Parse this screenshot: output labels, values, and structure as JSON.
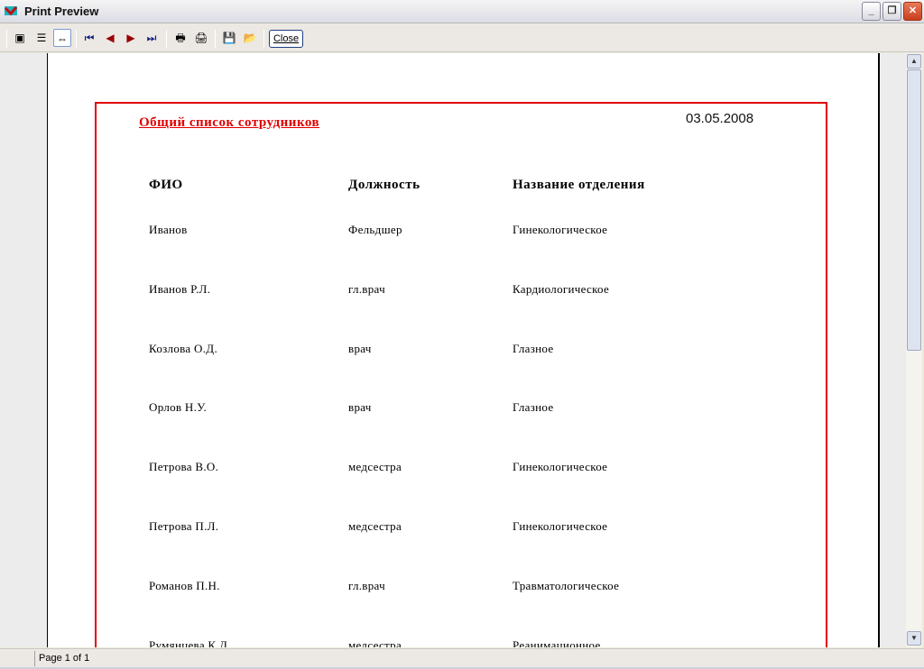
{
  "window": {
    "title": "Print Preview"
  },
  "toolbar": {
    "close_label": "Close"
  },
  "report": {
    "title": "Общий список сотрудников",
    "date": "03.05.2008",
    "headers": [
      "ФИО",
      "Должность",
      "Название отделения"
    ],
    "rows": [
      [
        "Иванов",
        "Фельдшер",
        "Гинекологическое"
      ],
      [
        "Иванов Р.Л.",
        "гл.врач",
        "Кардиологическое"
      ],
      [
        "Козлова О.Д.",
        "врач",
        "Глазное"
      ],
      [
        "Орлов Н.У.",
        "врач",
        "Глазное"
      ],
      [
        "Петрова В.О.",
        "медсестра",
        "Гинекологическое"
      ],
      [
        "Петрова П.Л.",
        "медсестра",
        "Гинекологическое"
      ],
      [
        "Романов П.Н.",
        "гл.врач",
        "Травматологическое"
      ],
      [
        "Румянцева К.Д.",
        "медсестра",
        "Реанимационное"
      ]
    ]
  },
  "status": {
    "page": "Page 1 of 1"
  }
}
